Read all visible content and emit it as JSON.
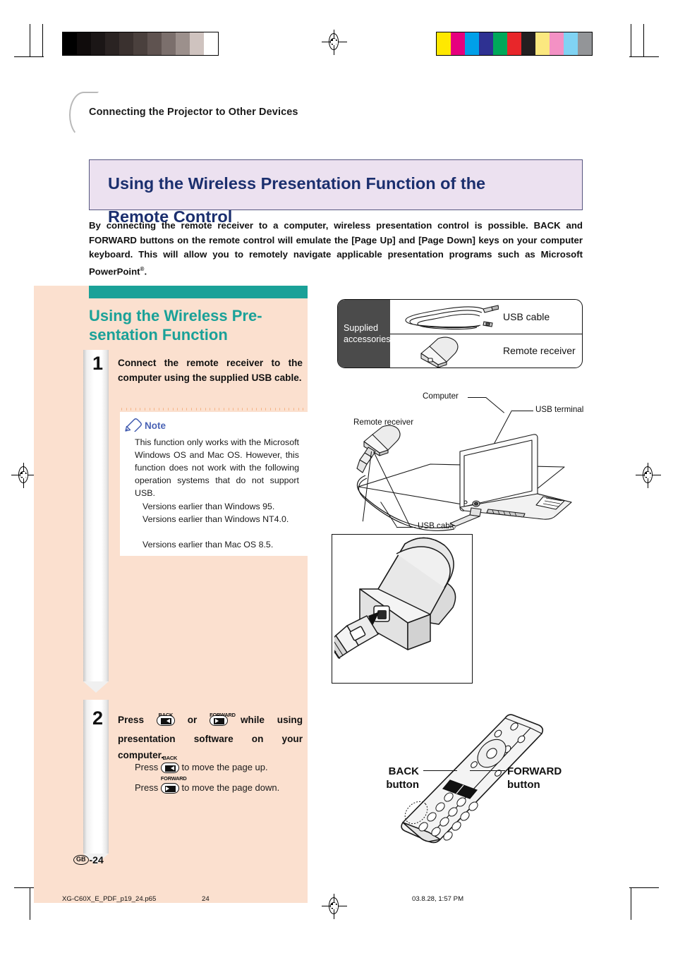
{
  "header": {
    "chapter": "Connecting the Projector to Other Devices",
    "title_line1": "Using the Wireless Presentation Function of the",
    "title_line2": "Remote Control"
  },
  "intro": {
    "text": "By connecting the remote receiver to a computer, wireless presentation control is possible. BACK and FORWARD buttons on the remote control will emulate the [Page Up] and [Page Down] keys on your computer keyboard. This will allow you to remotely navigate applicable presentation programs such as Microsoft PowerPoint",
    "superscript": "®",
    "period": "."
  },
  "left": {
    "section_heading_line1": "Using the Wireless Pre-",
    "section_heading_line2": "sentation Function",
    "step1": {
      "number": "1",
      "text": "Connect the remote receiver to the computer using the supplied USB cable."
    },
    "note": {
      "label": "Note",
      "icon": "pencil-icon",
      "paragraph": "This function only works with the Microsoft Windows OS and Mac OS. However, this function does not work with the following operation systems that do not support USB.",
      "bullets": [
        "Versions earlier than Windows 95.",
        "Versions earlier than Windows NT4.0.",
        "Versions earlier than Mac OS 8.5."
      ]
    },
    "step2": {
      "number": "2",
      "text_part1": "Press",
      "key_back_label": "BACK",
      "text_or": "or",
      "key_forward_label": "FORWARD",
      "text_part2": "while using presentation software on your computer.",
      "sub1_pre": "Press",
      "sub1_post": "to move the page up.",
      "sub2_pre": "Press",
      "sub2_post": "to move the page down."
    },
    "page_marker_region": "GB",
    "page_marker_number": "-24"
  },
  "right": {
    "accessories": {
      "side_label_line1": "Supplied",
      "side_label_line2": "accessories",
      "rows": [
        {
          "label": "USB cable",
          "icon": "usb-cable-illustration"
        },
        {
          "label": "Remote receiver",
          "icon": "remote-receiver-illustration"
        }
      ]
    },
    "diagram_labels": {
      "computer": "Computer",
      "usb_terminal": "USB terminal",
      "remote_receiver": "Remote receiver",
      "usb_cable": "USB cable"
    },
    "remote_labels": {
      "back_line1": "BACK",
      "back_line2": "button",
      "forward_line1": "FORWARD",
      "forward_line2": "button"
    }
  },
  "footer": {
    "filename": "XG-C60X_E_PDF_p19_24.p65",
    "page": "24",
    "timestamp": "03.8.28, 1:57 PM"
  },
  "colors": {
    "panel_peach": "#fbe0cf",
    "teal": "#1aa198",
    "title_navy": "#1b2f6e",
    "title_bg": "#ece1f0",
    "note_blue": "#4a63b5",
    "accessories_gray": "#4b4b4b"
  },
  "calibration": {
    "grayscale_bar": [
      "#000000",
      "#100c0c",
      "#1b1616",
      "#2a2322",
      "#3a312f",
      "#4a403d",
      "#5f5350",
      "#7b6f6c",
      "#9c908c",
      "#cfc3bf",
      "#ffffff"
    ],
    "color_bar": [
      "#ffe800",
      "#e6007e",
      "#00a0e9",
      "#2e3192",
      "#00a85a",
      "#e8262a",
      "#231f20",
      "#fbe87f",
      "#f391c4",
      "#80d3f3",
      "#939598"
    ]
  }
}
